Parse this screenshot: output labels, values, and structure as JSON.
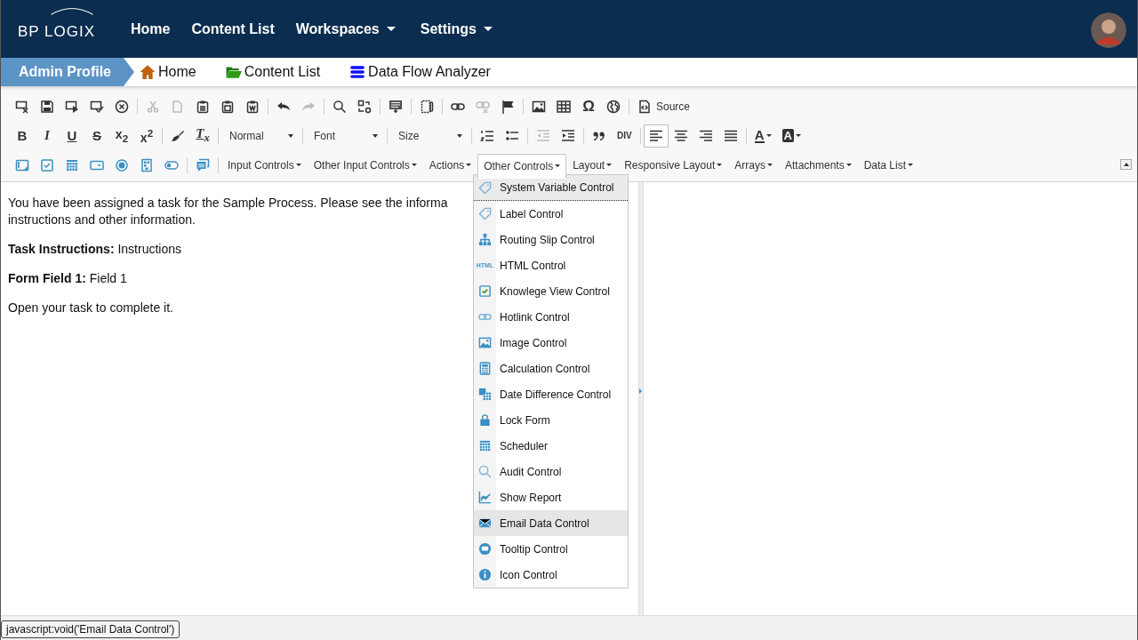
{
  "header": {
    "logo": "BP LOGIX",
    "nav": [
      {
        "label": "Home",
        "dropdown": false
      },
      {
        "label": "Content List",
        "dropdown": false
      },
      {
        "label": "Workspaces",
        "dropdown": true
      },
      {
        "label": "Settings",
        "dropdown": true
      }
    ]
  },
  "breadcrumb": {
    "profile": "Admin Profile",
    "tabs": [
      {
        "kind": "home",
        "label": "Home"
      },
      {
        "kind": "folder",
        "label": "Content List"
      },
      {
        "kind": "database",
        "label": "Data Flow Analyzer"
      }
    ]
  },
  "toolbar": {
    "rows": [
      {
        "groups": [
          [
            {
              "kind": "clear",
              "disabled": false
            },
            {
              "kind": "save",
              "disabled": false
            },
            {
              "kind": "savenext",
              "disabled": false
            },
            {
              "kind": "savecheck",
              "disabled": false
            },
            {
              "kind": "cancel",
              "disabled": false
            }
          ],
          [
            {
              "kind": "cut",
              "disabled": true
            },
            {
              "kind": "copy",
              "disabled": true
            },
            {
              "kind": "paste",
              "disabled": false
            },
            {
              "kind": "pastetext",
              "disabled": false
            },
            {
              "kind": "pasteword",
              "disabled": false
            }
          ],
          [
            {
              "kind": "undo",
              "disabled": false
            },
            {
              "kind": "redo",
              "disabled": true
            }
          ],
          [
            {
              "kind": "find",
              "disabled": false
            },
            {
              "kind": "replace",
              "disabled": false
            }
          ],
          [
            {
              "kind": "form",
              "disabled": false
            }
          ],
          [
            {
              "kind": "frame",
              "disabled": false
            }
          ],
          [
            {
              "kind": "link",
              "disabled": false
            },
            {
              "kind": "unlink",
              "disabled": true
            },
            {
              "kind": "flag",
              "disabled": false
            }
          ],
          [
            {
              "kind": "image",
              "disabled": false
            },
            {
              "kind": "table",
              "disabled": false
            },
            {
              "kind": "char",
              "text": "Ω",
              "disabled": false
            },
            {
              "kind": "globe",
              "disabled": false
            }
          ],
          [
            {
              "kind": "source",
              "text": "Source",
              "disabled": false
            }
          ]
        ]
      },
      {
        "groups": [
          [
            {
              "kind": "bold",
              "text": "B",
              "disabled": false
            },
            {
              "kind": "italic",
              "text": "I",
              "disabled": false
            },
            {
              "kind": "underline",
              "text": "U",
              "disabled": false
            },
            {
              "kind": "strike",
              "text": "S",
              "disabled": false
            },
            {
              "kind": "sub",
              "text": "x$_{2}$",
              "disabled": false
            },
            {
              "kind": "sup",
              "text": "x$^{2}$",
              "disabled": false
            }
          ],
          [
            {
              "kind": "brush",
              "disabled": false
            },
            {
              "kind": "removeformat",
              "text": "T$_{x}$",
              "disabled": false
            }
          ],
          [
            {
              "kind": "combo",
              "text": "Normal",
              "disabled": false
            }
          ],
          [
            {
              "kind": "combo",
              "text": "Font",
              "disabled": false
            }
          ],
          [
            {
              "kind": "combo",
              "text": "Size",
              "disabled": false
            }
          ],
          [
            {
              "kind": "ol",
              "disabled": false
            },
            {
              "kind": "ul",
              "disabled": false
            }
          ],
          [
            {
              "kind": "outdent",
              "disabled": true
            },
            {
              "kind": "indent",
              "disabled": false
            }
          ],
          [
            {
              "kind": "quote",
              "disabled": false
            },
            {
              "kind": "div",
              "text": "DIV",
              "disabled": false
            }
          ],
          [
            {
              "kind": "alignleft",
              "disabled": false,
              "selected": true
            },
            {
              "kind": "aligncenter",
              "disabled": false,
              "selected": false
            },
            {
              "kind": "alignright",
              "disabled": false,
              "selected": false
            },
            {
              "kind": "justify",
              "disabled": false,
              "selected": false
            }
          ],
          [
            {
              "kind": "textcolor",
              "text": "A",
              "disabled": false
            },
            {
              "kind": "bgcolor",
              "text": "A",
              "disabled": false
            }
          ]
        ]
      },
      {
        "groups": [
          [
            {
              "kind": "textbox",
              "disabled": false
            },
            {
              "kind": "checkbox",
              "disabled": false
            },
            {
              "kind": "calendar",
              "disabled": false
            },
            {
              "kind": "select",
              "disabled": false
            },
            {
              "kind": "radio",
              "disabled": false
            },
            {
              "kind": "grid",
              "disabled": false
            },
            {
              "kind": "toggle",
              "disabled": false
            }
          ],
          [
            {
              "kind": "comment",
              "disabled": false
            }
          ],
          [
            {
              "kind": "menu",
              "text": "Input Controls",
              "selected": false
            },
            {
              "kind": "menu",
              "text": "Other Input Controls",
              "selected": false
            },
            {
              "kind": "menu",
              "text": "Actions",
              "selected": false
            },
            {
              "kind": "menu",
              "text": "Other Controls",
              "selected": true
            },
            {
              "kind": "menu",
              "text": "Layout",
              "selected": false
            },
            {
              "kind": "menu",
              "text": "Responsive Layout",
              "selected": false
            },
            {
              "kind": "menu",
              "text": "Arrays",
              "selected": false
            },
            {
              "kind": "menu",
              "text": "Attachments",
              "selected": false
            },
            {
              "kind": "menu",
              "text": "Data List",
              "selected": false
            }
          ]
        ]
      }
    ]
  },
  "content": {
    "paragraphs": [
      [
        "You have been assigned a task for the Sample Process. Please see the informa",
        "instructions and other information."
      ],
      [
        "**Task Instructions:** Instructions"
      ],
      [
        "**Form Field 1:** Field 1"
      ],
      [
        "Open your task to complete it."
      ]
    ]
  },
  "menu": {
    "items": [
      {
        "kind": "tag",
        "label": "System Variable Control",
        "focused": true,
        "hovered": false
      },
      {
        "kind": "tag",
        "label": "Label Control",
        "focused": false,
        "hovered": false
      },
      {
        "kind": "sitemap",
        "label": "Routing Slip Control",
        "focused": false,
        "hovered": false
      },
      {
        "kind": "html",
        "icon_text": "HTML",
        "label": "HTML Control",
        "focused": false,
        "hovered": false
      },
      {
        "kind": "check",
        "label": "Knowlege View Control",
        "focused": false,
        "hovered": false
      },
      {
        "kind": "link",
        "label": "Hotlink Control",
        "focused": false,
        "hovered": false
      },
      {
        "kind": "image",
        "label": "Image Control",
        "focused": false,
        "hovered": false
      },
      {
        "kind": "calc",
        "label": "Calculation Control",
        "focused": false,
        "hovered": false
      },
      {
        "kind": "datediff",
        "label": "Date Difference Control",
        "focused": false,
        "hovered": false
      },
      {
        "kind": "lock",
        "label": "Lock Form",
        "focused": false,
        "hovered": false
      },
      {
        "kind": "calendar",
        "label": "Scheduler",
        "focused": false,
        "hovered": false
      },
      {
        "kind": "search",
        "label": "Audit Control",
        "focused": false,
        "hovered": false
      },
      {
        "kind": "chart",
        "label": "Show Report",
        "focused": false,
        "hovered": false
      },
      {
        "kind": "mail",
        "label": "Email Data Control",
        "focused": false,
        "hovered": true
      },
      {
        "kind": "chat",
        "label": "Tooltip Control",
        "focused": false,
        "hovered": false
      },
      {
        "kind": "info",
        "label": "Icon Control",
        "focused": false,
        "hovered": false
      }
    ]
  },
  "status_tooltip": "javascript:void('Email Data Control')"
}
